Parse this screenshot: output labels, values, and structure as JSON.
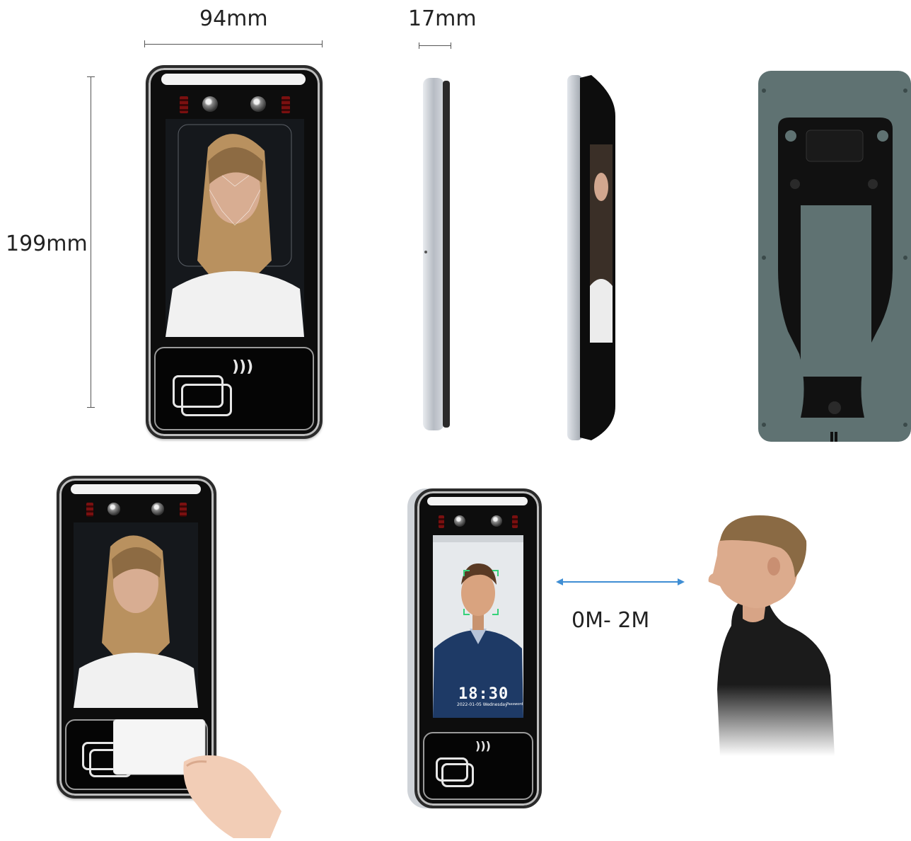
{
  "dimensions": {
    "width_label": "94mm",
    "depth_label": "17mm",
    "height_label": "199mm"
  },
  "distance": {
    "label": "0M- 2M",
    "arrow_color": "#3f8ed4"
  },
  "device_screen": {
    "time": "18:30",
    "date": "2022-01-05 Wednesday",
    "passwd": "Password"
  },
  "colors": {
    "frame": "#0d0d0d",
    "side_silver": "#b7bcc4",
    "back_plate": "#5f7272",
    "bracket": "#111111"
  },
  "icons": [
    "nfc-wave-icon",
    "card-icon",
    "camera-icon",
    "ir-sensor-icon"
  ]
}
